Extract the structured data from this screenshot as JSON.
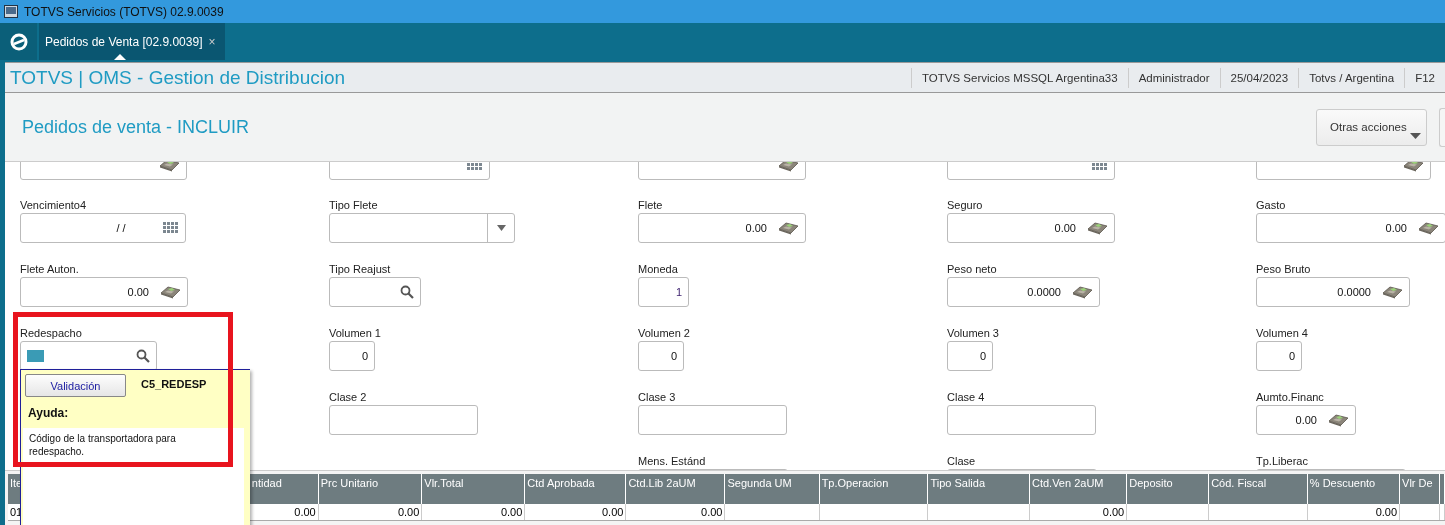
{
  "window": {
    "title": "TOTVS Servicios (TOTVS) 02.9.0039"
  },
  "tabs": [
    {
      "label": "Pedidos de Venta [02.9.0039]",
      "close": "×",
      "selected": true
    }
  ],
  "app_header": {
    "title": "TOTVS | OMS - Gestion de Distribucion",
    "info": [
      "TOTVS Servicios MSSQL Argentina33",
      "Administrador",
      "25/04/2023",
      "Totvs / Argentina",
      "F12"
    ]
  },
  "page": {
    "title": "Pedidos de venta - INCLUIR",
    "actions": [
      {
        "label": "Otras acciones"
      }
    ]
  },
  "form": {
    "rows": [
      [
        {
          "kind": "money"
        },
        {
          "kind": "date"
        },
        {
          "kind": "money"
        },
        {
          "kind": "date"
        },
        {
          "kind": "money"
        }
      ],
      [
        {
          "label": "Vencimiento4",
          "kind": "date",
          "value": "/ /"
        },
        {
          "label": "Tipo Flete",
          "kind": "combo"
        },
        {
          "label": "Flete",
          "kind": "money",
          "value": "0.00"
        },
        {
          "label": "Seguro",
          "kind": "money",
          "value": "0.00"
        },
        {
          "label": "Gasto",
          "kind": "money",
          "value": "0.00"
        }
      ],
      [
        {
          "label": "Flete Auton.",
          "kind": "money",
          "value": "0.00"
        },
        {
          "label": "Tipo Reajust",
          "kind": "lookup"
        },
        {
          "label": "Moneda",
          "kind": "text",
          "value": "1"
        },
        {
          "label": "Peso neto",
          "kind": "money",
          "value": "0.0000"
        },
        {
          "label": "Peso Bruto",
          "kind": "money",
          "value": "0.0000"
        }
      ],
      [
        {
          "label": "Redespacho",
          "kind": "lookup",
          "focused": true
        },
        {
          "label": "Volumen 1",
          "kind": "text",
          "value": "0"
        },
        {
          "label": "Volumen 2",
          "kind": "text",
          "value": "0"
        },
        {
          "label": "Volumen 3",
          "kind": "text",
          "value": "0"
        },
        {
          "label": "Volumen 4",
          "kind": "text",
          "value": "0"
        }
      ],
      [
        null,
        {
          "label": "Clase 2",
          "kind": "text"
        },
        {
          "label": "Clase 3",
          "kind": "text"
        },
        {
          "label": "Clase 4",
          "kind": "text"
        },
        {
          "label": "Aumto.Financ",
          "kind": "money",
          "value": "0.00"
        }
      ],
      [
        null,
        null,
        {
          "label": "Mens. Estánd",
          "kind": "text"
        },
        {
          "label": "Clase",
          "kind": "text"
        },
        {
          "label": "Tp.Liberac",
          "kind": "text"
        }
      ]
    ]
  },
  "grid": {
    "columns": [
      "Ite",
      "ntidad",
      "Prc Unitario",
      "Vlr.Total",
      "Ctd Aprobada",
      "Ctd.Lib 2aUM",
      "Segunda UM",
      "Tp.Operacion",
      "Tipo Salida",
      "Ctd.Ven 2aUM",
      "Deposito",
      "Cód. Fiscal",
      "% Descuento",
      "Vlr De"
    ],
    "rows": [
      [
        "01",
        "0.00",
        "0.00",
        "0.00",
        "0.00",
        "0.00",
        null,
        null,
        null,
        "0.00",
        null,
        null,
        "0.00",
        null
      ]
    ]
  },
  "help_popup": {
    "button": "Validación",
    "field_name": "C5_REDESP",
    "help_title": "Ayuda:",
    "help_text": "Código de la transportadora para redespacho."
  },
  "annotation": {
    "kind": "frame",
    "color": "#e8141e"
  }
}
